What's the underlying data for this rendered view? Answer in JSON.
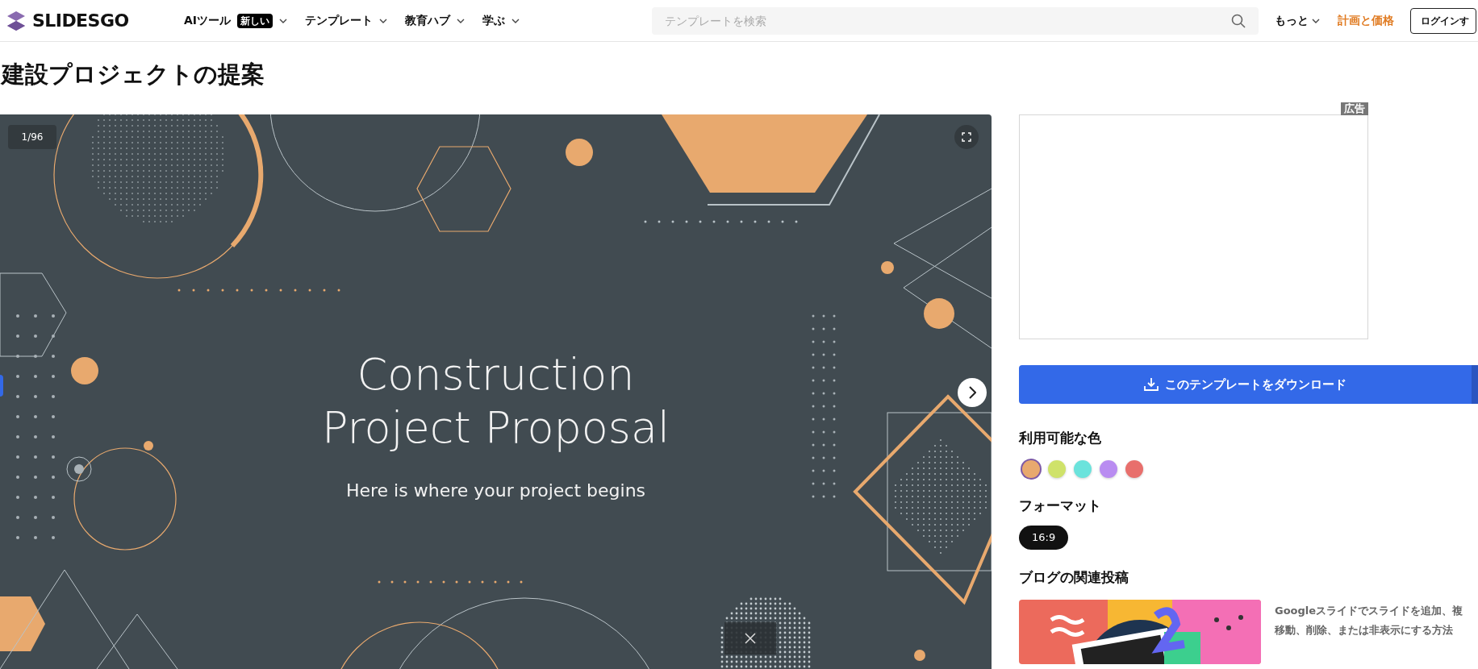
{
  "header": {
    "logo": "SLIDESGO",
    "nav": [
      {
        "label": "AIツール",
        "badge": "新しい"
      },
      {
        "label": "テンプレート"
      },
      {
        "label": "教育ハブ"
      },
      {
        "label": "学ぶ"
      }
    ],
    "search": {
      "placeholder": "テンプレートを検索"
    },
    "more": "もっと",
    "pricing": "計画と価格",
    "login": "ログインす"
  },
  "title": "建設プロジェクトの提案",
  "slide": {
    "counter": "1/96",
    "title_lines": [
      "Construction",
      "Project Proposal"
    ],
    "subtitle": "Here is where your project begins"
  },
  "ad": {
    "label": "広告"
  },
  "download": {
    "label": "このテンプレートをダウンロード"
  },
  "colors_heading": "利用可能な色",
  "colors": [
    {
      "color": "#e8a96e",
      "selected": true
    },
    {
      "color": "#cfe26a",
      "selected": false
    },
    {
      "color": "#6be3dc",
      "selected": false
    },
    {
      "color": "#b98cf1",
      "selected": false
    },
    {
      "color": "#e86f6c",
      "selected": false
    }
  ],
  "format_heading": "フォーマット",
  "formats": [
    {
      "label": "16:9",
      "selected": true
    }
  ],
  "blog_heading": "ブログの関連投稿",
  "blog_post": {
    "lines": [
      "Googleスライドでスライドを追加、複",
      "移動、削除、または非表示にする方法"
    ]
  }
}
